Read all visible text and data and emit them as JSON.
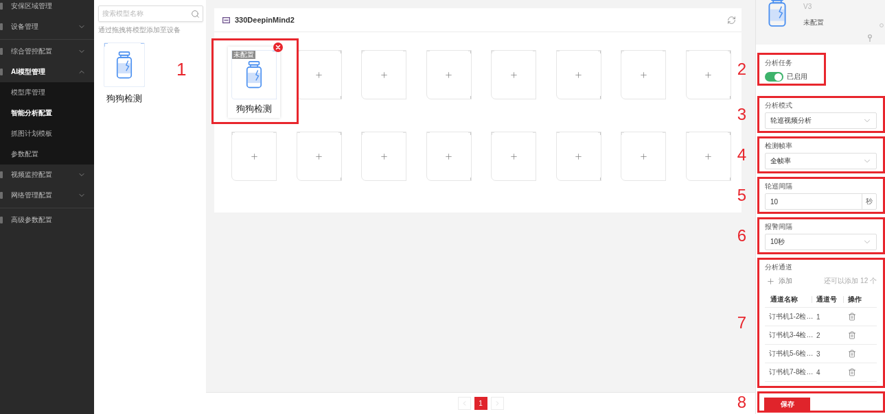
{
  "sidebar": {
    "sections": [
      {
        "items": [
          {
            "kind": "link",
            "label": "安保区域管理",
            "selected": false
          },
          {
            "kind": "group",
            "label": "设备管理",
            "expanded": false
          }
        ]
      },
      {
        "items": [
          {
            "kind": "group",
            "label": "综合管控配置",
            "expanded": false
          },
          {
            "kind": "group",
            "label": "AI模型管理",
            "expanded": true,
            "children": [
              {
                "label": "模型库管理",
                "selected": false
              },
              {
                "label": "智能分析配置",
                "selected": true
              },
              {
                "label": "抓图计划模板",
                "selected": false
              },
              {
                "label": "参数配置",
                "selected": false
              }
            ]
          },
          {
            "kind": "group",
            "label": "视频监控配置",
            "expanded": false
          },
          {
            "kind": "group",
            "label": "网络管理配置",
            "expanded": false
          }
        ]
      },
      {
        "items": [
          {
            "kind": "link",
            "label": "高级参数配置",
            "selected": false
          }
        ]
      }
    ]
  },
  "model_panel": {
    "search": {
      "placeholder": "搜索模型名称"
    },
    "hint": "通过拖拽将模型添加至设备",
    "models": [
      {
        "name": "狗狗检测"
      }
    ],
    "annotation": "1"
  },
  "device": {
    "name": "330DeepinMind2",
    "slots": [
      {
        "kind": "model",
        "name": "狗狗检测",
        "badge": "未配置",
        "highlighted": true
      },
      {
        "kind": "empty"
      },
      {
        "kind": "empty"
      },
      {
        "kind": "empty"
      },
      {
        "kind": "empty"
      },
      {
        "kind": "empty"
      },
      {
        "kind": "empty"
      },
      {
        "kind": "empty"
      },
      {
        "kind": "empty"
      },
      {
        "kind": "empty"
      },
      {
        "kind": "empty"
      },
      {
        "kind": "empty"
      },
      {
        "kind": "empty"
      },
      {
        "kind": "empty"
      },
      {
        "kind": "empty"
      },
      {
        "kind": "empty"
      }
    ]
  },
  "pagination": {
    "prev": {
      "disabled": true
    },
    "pages": [
      {
        "label": "1",
        "selected": true
      }
    ],
    "next": {
      "disabled": true
    }
  },
  "device_info": {
    "version": "V3",
    "status": "未配置"
  },
  "settings": [
    {
      "kind": "toggle",
      "annotation": "2",
      "highlighted": true,
      "label": "分析任务",
      "on": true,
      "value_label": "已启用"
    },
    {
      "kind": "select",
      "annotation": "3",
      "highlighted": true,
      "label": "分析模式",
      "value": "轮巡视频分析"
    },
    {
      "kind": "select",
      "annotation": "4",
      "highlighted": true,
      "label": "检测帧率",
      "value": "全帧率"
    },
    {
      "kind": "number",
      "annotation": "5",
      "highlighted": true,
      "label": "轮巡间隔",
      "value": "10",
      "unit": "秒"
    },
    {
      "kind": "select",
      "annotation": "6",
      "highlighted": true,
      "label": "报警间隔",
      "value": "10秒"
    },
    {
      "kind": "channels",
      "annotation": "7",
      "highlighted": true,
      "label": "分析通道",
      "add_label": "添加",
      "remaining": "还可以添加 12 个",
      "columns": [
        "通道名称",
        "通道号",
        "操作"
      ],
      "rows": [
        {
          "name": "订书机1-2检…",
          "number": "1"
        },
        {
          "name": "订书机3-4检…",
          "number": "2"
        },
        {
          "name": "订书机5-6检…",
          "number": "3"
        },
        {
          "name": "订书机7-8检…",
          "number": "4"
        }
      ]
    },
    {
      "kind": "save",
      "annotation": "8",
      "highlighted": true,
      "button": "保存"
    }
  ]
}
